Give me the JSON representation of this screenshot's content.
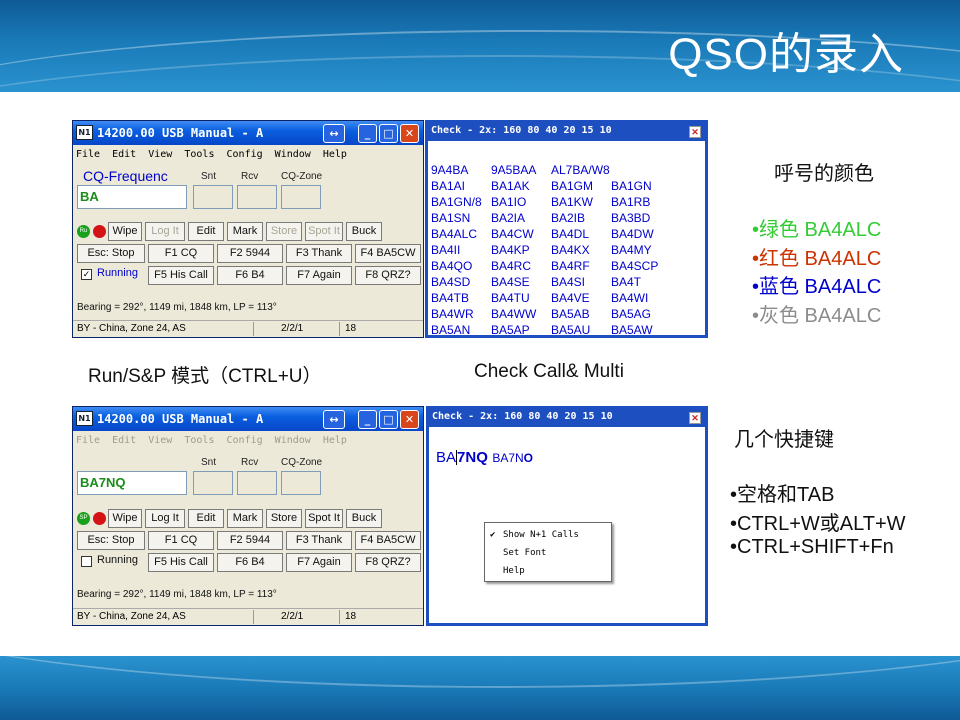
{
  "slide": {
    "title": "QSO的录入"
  },
  "logger_window": {
    "title": "14200.00 USB Manual - A",
    "app_icon": "N1",
    "menu": [
      "File",
      "Edit",
      "View",
      "Tools",
      "Config",
      "Window",
      "Help"
    ],
    "group_label": "CQ-Frequenc",
    "labels": {
      "snt": "Snt",
      "rcv": "Rcv",
      "cqzone": "CQ-Zone"
    },
    "call_value": "BA",
    "buttons_row1": [
      "Wipe",
      "Log It",
      "Edit",
      "Mark",
      "Store",
      "Spot It",
      "Buck"
    ],
    "buttons_row2": [
      "Esc: Stop",
      "F1 CQ",
      "F2 5944",
      "F3 Thank",
      "F4 BA5CW"
    ],
    "buttons_row3": [
      "F5 His Call",
      "F6 B4",
      "F7 Again",
      "F8 QRZ?"
    ],
    "running_label": "Running",
    "run_dot_label": "Ru",
    "bearing": "Bearing = 292°, 1149  mi, 1848 km, LP = 113°",
    "status": [
      "BY - China, Zone 24, AS",
      "2/2/1",
      "18"
    ]
  },
  "check_window_top": {
    "title": "Check - 2x: 160 80 40 20 15 10",
    "calls": [
      "9A4BA",
      "9A5BAA",
      "AL7BA/W8",
      "",
      "BA1AI",
      "BA1AK",
      "BA1GM",
      "BA1GN",
      "BA1GN/8",
      "BA1IO",
      "BA1KW",
      "BA1RB",
      "BA1SN",
      "BA2IA",
      "BA2IB",
      "BA3BD",
      "BA4ALC",
      "BA4CW",
      "BA4DL",
      "BA4DW",
      "BA4II",
      "BA4KP",
      "BA4KX",
      "BA4MY",
      "BA4QO",
      "BA4RC",
      "BA4RF",
      "BA4SCP",
      "BA4SD",
      "BA4SE",
      "BA4SI",
      "BA4T",
      "BA4TB",
      "BA4TU",
      "BA4VE",
      "BA4WI",
      "BA4WR",
      "BA4WW",
      "BA5AB",
      "BA5AG",
      "BA5AN",
      "BA5AP",
      "BA5AU",
      "BA5AW"
    ]
  },
  "logger_window_bottom": {
    "title": "14200.00 USB Manual - A",
    "call_value": "BA7NQ",
    "run_dot_label": "SP",
    "status": [
      "BY - China, Zone 24, AS",
      "2/2/1",
      "18"
    ]
  },
  "check_window_bottom": {
    "title": "Check - 2x: 160 80 40 20 15 10",
    "typed_a": "BA",
    "typed_b": "7NQ",
    "suggest_a": "BA7N",
    "suggest_b": "O",
    "context_menu": [
      "Show N+1 Calls",
      "Set Font",
      "Help"
    ]
  },
  "captions": {
    "left": "Run/S&P 模式（CTRL+U）",
    "middle": "Check Call& Multi"
  },
  "right_panel": {
    "color_title": "呼号的颜色",
    "colors": [
      {
        "text": "•绿色 BA4ALC",
        "color": "#33cc33"
      },
      {
        "text": "•红色 BA4ALC",
        "color": "#cc3300"
      },
      {
        "text": "•蓝色 BA4ALC",
        "color": "#0000cc"
      },
      {
        "text": "•灰色 BA4ALC",
        "color": "#8c8c8c"
      }
    ],
    "hotkey_title": "几个快捷键",
    "hotkeys": [
      "•空格和TAB",
      "•CTRL+W或ALT+W",
      "•CTRL+SHIFT+Fn"
    ]
  }
}
